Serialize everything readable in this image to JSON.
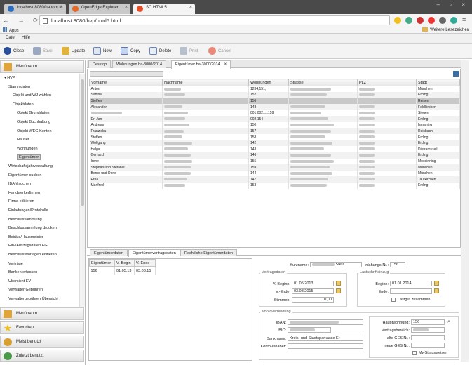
{
  "browser": {
    "tabs": [
      {
        "label": "localhost:8080/hattom.#"
      },
      {
        "label": "OpenEdge Explorer"
      },
      {
        "label": "SC HTML5"
      }
    ],
    "url": "localhost:8080/hvp/html5.html",
    "apps_label": "Apps",
    "bookmarks_right": "Weitere Lesezeichen"
  },
  "menu": {
    "datei": "Datei",
    "hilfe": "Hilfe"
  },
  "toolbar": {
    "close": "Close",
    "save": "Save",
    "update": "Update",
    "new": "New",
    "copy": "Copy",
    "delete": "Delete",
    "print": "Print",
    "cancel": "Cancel"
  },
  "sidebar": {
    "menubaum_top": "Menübaum",
    "tree": [
      {
        "label": "HVP",
        "level": 0
      },
      {
        "label": "Stammdaten",
        "level": 1
      },
      {
        "label": "Objekt und WJ wählen",
        "level": 2
      },
      {
        "label": "Objektdaten",
        "level": 2
      },
      {
        "label": "Objekt Grunddaten",
        "level": 3
      },
      {
        "label": "Objekt Buchhaltung",
        "level": 3
      },
      {
        "label": "Objekt WEG Konten",
        "level": 3
      },
      {
        "label": "Häuser",
        "level": 3
      },
      {
        "label": "Wohnungen",
        "level": 3
      },
      {
        "label": "Eigentümer",
        "level": 3,
        "selected": true
      },
      {
        "label": "Wirtschaftsjahrverwaltung",
        "level": 1
      },
      {
        "label": "Eigentümer suchen",
        "level": 1
      },
      {
        "label": "IBAN suchen",
        "level": 1
      },
      {
        "label": "Handwerkerfirmen",
        "level": 1
      },
      {
        "label": "Firma editieren",
        "level": 1
      },
      {
        "label": "Einladungen/Protokolle",
        "level": 1
      },
      {
        "label": "Beschlussammlung",
        "level": 1
      },
      {
        "label": "Beschlussammlung drucken",
        "level": 1
      },
      {
        "label": "Beiräte/Hausmeister",
        "level": 1
      },
      {
        "label": "Ein-/Auszugsdaten EG",
        "level": 1
      },
      {
        "label": "Beschlussvorlagen editieren",
        "level": 1
      },
      {
        "label": "Verträge",
        "level": 1
      },
      {
        "label": "Banken erfassen",
        "level": 1
      },
      {
        "label": "Übersicht EV",
        "level": 1
      },
      {
        "label": "Verwalter Gebühren",
        "level": 1
      },
      {
        "label": "Verwaltergebühren Übersicht",
        "level": 1
      }
    ],
    "bottom": [
      {
        "label": "Menübaum"
      },
      {
        "label": "Favoriten"
      },
      {
        "label": "Meist benutzt"
      },
      {
        "label": "Zuletzt benutzt"
      }
    ]
  },
  "main_tabs": [
    {
      "label": "Desktop"
    },
    {
      "label": "Wohnungen ba-3000/2014"
    },
    {
      "label": "Eigentümer ba-3000/2014"
    }
  ],
  "grid": {
    "columns": [
      "Vorname",
      "Nachname",
      "Wohnungen",
      "Strasse",
      "PLZ",
      "Stadt"
    ],
    "rows": [
      {
        "vorname": "Anton",
        "wohnungen": "1234,151,",
        "stadt": "München"
      },
      {
        "vorname": "Sabine",
        "wohnungen": "152",
        "stadt": "Erding"
      },
      {
        "vorname": "Steffen",
        "wohnungen": "156",
        "stadt": "Reisen",
        "selected": true
      },
      {
        "vorname": "Alexander",
        "wohnungen": "148",
        "stadt": "Feldkirchen"
      },
      {
        "vorname": "",
        "wohnungen": "001,002,...,159",
        "stadt": "Siegen"
      },
      {
        "vorname": "Dr. Jan",
        "wohnungen": "002,154",
        "stadt": "Erding"
      },
      {
        "vorname": "Andreas",
        "wohnungen": "150",
        "stadt": "Ismaning"
      },
      {
        "vorname": "Franziska",
        "wohnungen": "157",
        "stadt": "Reisbach"
      },
      {
        "vorname": "Steffen",
        "wohnungen": "158",
        "stadt": "Erding"
      },
      {
        "vorname": "Wolfgang",
        "wohnungen": "142",
        "stadt": "Erding"
      },
      {
        "vorname": "Helga",
        "wohnungen": "143",
        "stadt": "Dietramszell"
      },
      {
        "vorname": "Gerhard",
        "wohnungen": "146",
        "stadt": "Erding"
      },
      {
        "vorname": "Irene",
        "wohnungen": "155",
        "stadt": "Moosinning"
      },
      {
        "vorname": "Stephan und Stefanie",
        "wohnungen": "159",
        "stadt": "München"
      },
      {
        "vorname": "Bernd und Doris",
        "wohnungen": "144",
        "stadt": "München"
      },
      {
        "vorname": "Erna",
        "wohnungen": "147",
        "stadt": "Taufkirchen"
      },
      {
        "vorname": "Manfred",
        "wohnungen": "153",
        "stadt": "Erding"
      }
    ]
  },
  "bottom_tabs": [
    {
      "label": "Eigentümerdaten"
    },
    {
      "label": "Eigentümervertragsdaten"
    },
    {
      "label": "Rechtliche Eigentümerdaten"
    }
  ],
  "contracts": {
    "columns": [
      "Eigentümer",
      "V.-Begin",
      "V.-Ende"
    ],
    "rows": [
      {
        "eigentuemer": "156",
        "begin": "01.05.13",
        "ende": "03.08.15"
      }
    ]
  },
  "details": {
    "kurzname_label": "Kurzname:",
    "kurzname_value": "Stefa",
    "inlnr_label": "Inlahungs-Nr.:",
    "inlnr_value": "156",
    "vertragsdaten_title": "Vertragsdaten",
    "vbeginn_label": "V.-Beginn:",
    "vbeginn_value": "01.05.2013",
    "vende_label": "V.-Ende:",
    "vende_value": "03.08.2015",
    "stimmen_label": "Stimmen:",
    "stimmen_value": "0,00",
    "lastschrift_title": "Lastschrifteinzug",
    "beginn_label": "Beginn:",
    "beginn_value": "01.01.2014",
    "ende_label": "Ende:",
    "ende_value": "",
    "lastgut_label": "Lastgut zusammen",
    "konto_title": "Kontoverbindung",
    "iban_label": "IBAN:",
    "bic_label": "BIC:",
    "bankname_label": "Bankname:",
    "bankname_value": "Kreis- und Stadtsparkasse Er",
    "kontoinhaber_label": "Konto-Inhaber:",
    "hauptwohnung_label": "Hauptwohnung:",
    "hauptwohnung_value": "156",
    "vertragsbereich_label": "Vertragsbereich:",
    "alte_ges_label": "alte GES.Nr.:",
    "neue_ges_label": "neue GES.Nr.:",
    "mwst_label": "MwSt ausweisen"
  },
  "colors": {
    "selection": "#c8c8c8",
    "tabbar": "#4a4a4a",
    "accent": "#3a6ea5"
  }
}
